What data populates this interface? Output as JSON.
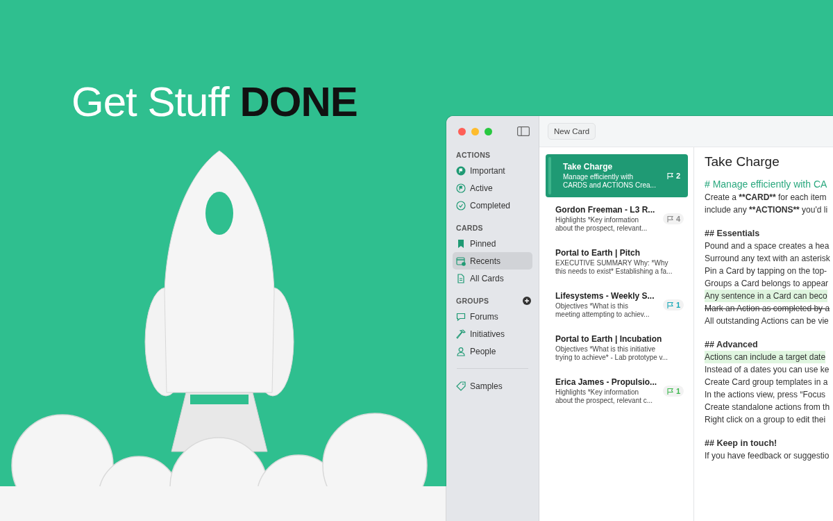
{
  "headline": "Get Stuff **DONE**",
  "window": {
    "toolbar": {
      "new_button": "New Card"
    },
    "sidebar": {
      "sections": [
        {
          "title": "ACTIONS",
          "has_add": false,
          "items": [
            {
              "label": "Important",
              "selected": false
            },
            {
              "label": "Active",
              "selected": false
            },
            {
              "label": "Completed",
              "selected": false
            }
          ]
        },
        {
          "title": "CARDS",
          "has_add": false,
          "items": [
            {
              "label": "Pinned",
              "selected": false
            },
            {
              "label": "Recents",
              "selected": true
            },
            {
              "label": "All Cards",
              "selected": false
            }
          ]
        },
        {
          "title": "GROUPS",
          "has_add": true,
          "items": [
            {
              "label": "Forums",
              "selected": false
            },
            {
              "label": "Initiatives",
              "selected": false
            },
            {
              "label": "People",
              "selected": false
            }
          ]
        }
      ],
      "footer_items": [
        {
          "label": "Samples",
          "selected": false
        }
      ]
    },
    "cards": [
      {
        "title": "Take Charge",
        "preview": [
          "Manage efficiently with",
          "CARDS and ACTIONS Crea..."
        ],
        "flags": "2",
        "color": "#ffffff",
        "selected": true
      },
      {
        "title": "Gordon Freeman - L3 R...",
        "preview": [
          "Highlights *Key information",
          "about the prospect, relevant..."
        ],
        "flags": "4",
        "color": "#8a8a8a",
        "selected": false
      },
      {
        "title": "Portal to Earth | Pitch",
        "preview": [
          "EXECUTIVE SUMMARY   Why: *Why",
          "this needs to exist* Establishing a fa..."
        ],
        "selected": false
      },
      {
        "title": "Lifesystems - Weekly S...",
        "preview": [
          "Objectives *What is this",
          "meeting attempting to achiev..."
        ],
        "flags": "1",
        "color": "#1aa9b8",
        "selected": false
      },
      {
        "title": "Portal to Earth | Incubation",
        "preview": [
          "Objectives *What is this initiative",
          "trying to achieve* - Lab prototype v..."
        ],
        "selected": false
      },
      {
        "title": "Erica James - Propulsio...",
        "preview": [
          "Highlights *Key information",
          "about the prospect, relevant c..."
        ],
        "flags": "1",
        "color": "#3fb950",
        "selected": false
      }
    ],
    "editor": {
      "title": "Take Charge",
      "lines": [
        {
          "kind": "h1",
          "text": "# Manage efficiently with CA"
        },
        {
          "kind": "text",
          "parts": [
            {
              "text": "Create a ",
              "bold": false
            },
            {
              "text": "**CARD**",
              "bold": true
            },
            {
              "text": " for each item",
              "bold": false
            }
          ]
        },
        {
          "kind": "text",
          "parts": [
            {
              "text": "include any ",
              "bold": false
            },
            {
              "text": "**ACTIONS**",
              "bold": true
            },
            {
              "text": " you'd li",
              "bold": false
            }
          ]
        },
        {
          "kind": "h2",
          "text": "## Essentials"
        },
        {
          "kind": "text",
          "text": "Pound and a space creates a hea"
        },
        {
          "kind": "text",
          "text": "Surround any text with an asterisk"
        },
        {
          "kind": "text",
          "text": "Pin a Card by tapping on the top-"
        },
        {
          "kind": "text",
          "text": "Groups a Card belongs to appear"
        },
        {
          "kind": "highlight",
          "text": "Any sentence in a Card can beco"
        },
        {
          "kind": "strike",
          "text": "Mark an Action as completed by a"
        },
        {
          "kind": "text",
          "text": "All outstanding Actions can be vie"
        },
        {
          "kind": "h2",
          "text": "## Advanced"
        },
        {
          "kind": "highlight",
          "text": "Actions can include a target date"
        },
        {
          "kind": "text",
          "text": "Instead of a dates you can use ke"
        },
        {
          "kind": "text",
          "text": "Create Card group templates in a"
        },
        {
          "kind": "text",
          "text": "In the actions view,  press “Focus"
        },
        {
          "kind": "text",
          "text": "Create standalone actions from th"
        },
        {
          "kind": "text",
          "text": "Right click on a group to edit thei"
        },
        {
          "kind": "h2",
          "text": "## Keep in touch!"
        },
        {
          "kind": "text",
          "text": "If you have feedback or suggestio"
        }
      ]
    }
  }
}
